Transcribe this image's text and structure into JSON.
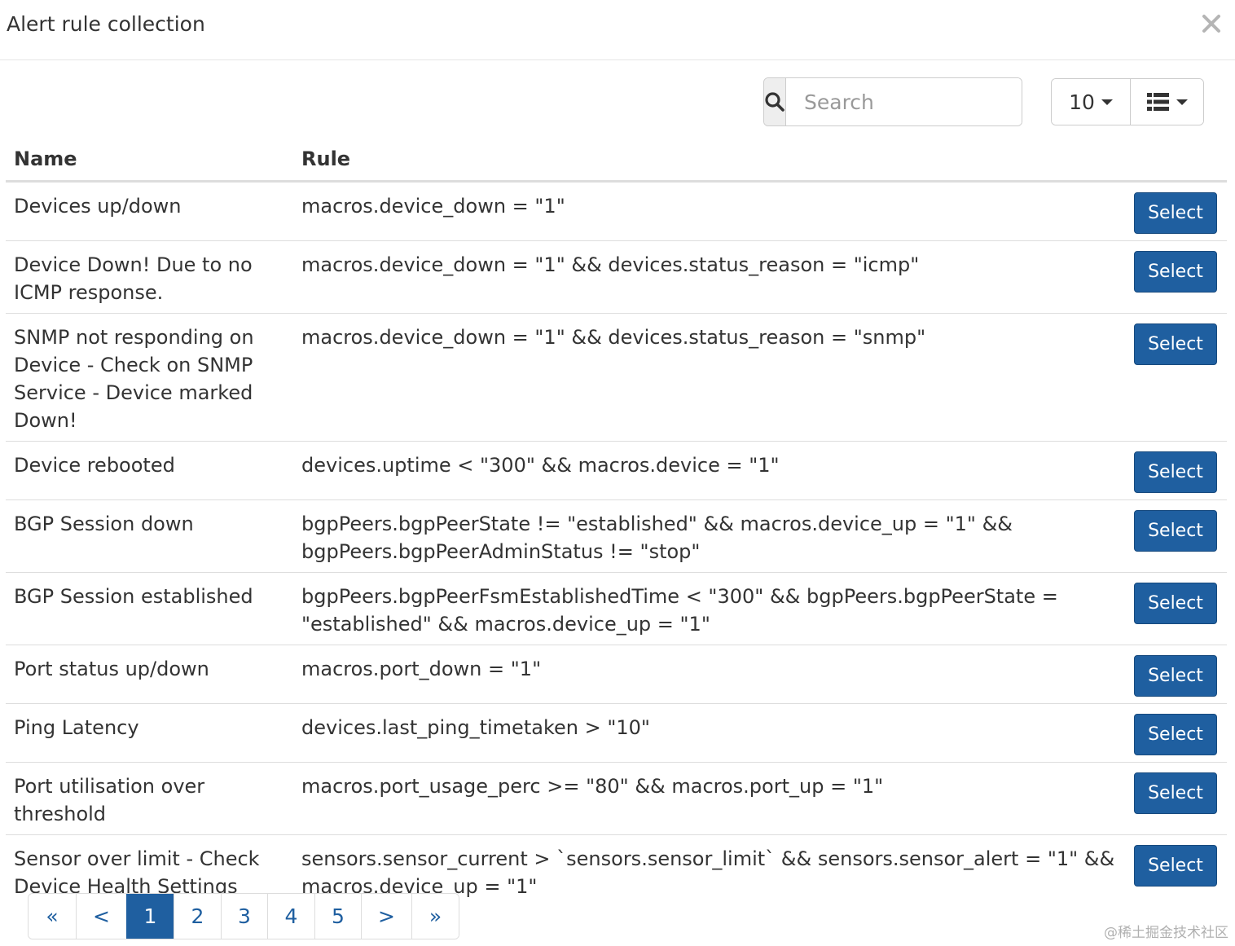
{
  "modal": {
    "title": "Alert rule collection"
  },
  "toolbar": {
    "search_placeholder": "Search",
    "page_size": "10"
  },
  "table": {
    "headers": {
      "name": "Name",
      "rule": "Rule"
    },
    "select_label": "Select",
    "rows": [
      {
        "name": "Devices up/down",
        "rule": "macros.device_down = \"1\""
      },
      {
        "name": "Device Down! Due to no ICMP response.",
        "rule": "macros.device_down = \"1\" && devices.status_reason = \"icmp\""
      },
      {
        "name": "SNMP not responding on Device - Check on SNMP Service - Device marked Down!",
        "rule": "macros.device_down = \"1\" && devices.status_reason = \"snmp\""
      },
      {
        "name": "Device rebooted",
        "rule": "devices.uptime < \"300\" && macros.device = \"1\""
      },
      {
        "name": "BGP Session down",
        "rule": "bgpPeers.bgpPeerState != \"established\" && macros.device_up = \"1\" && bgpPeers.bgpPeerAdminStatus != \"stop\""
      },
      {
        "name": "BGP Session established",
        "rule": "bgpPeers.bgpPeerFsmEstablishedTime < \"300\" && bgpPeers.bgpPeerState = \"established\" && macros.device_up = \"1\""
      },
      {
        "name": "Port status up/down",
        "rule": "macros.port_down = \"1\""
      },
      {
        "name": "Ping Latency",
        "rule": "devices.last_ping_timetaken > \"10\""
      },
      {
        "name": "Port utilisation over threshold",
        "rule": "macros.port_usage_perc >= \"80\" && macros.port_up = \"1\""
      },
      {
        "name": "Sensor over limit - Check Device Health Settings",
        "rule": "sensors.sensor_current > `sensors.sensor_limit` && sensors.sensor_alert = \"1\" && macros.device_up = \"1\""
      }
    ]
  },
  "pagination": {
    "first": "«",
    "prev": "<",
    "pages": [
      "1",
      "2",
      "3",
      "4",
      "5"
    ],
    "next": ">",
    "last": "»",
    "active_page": "1"
  },
  "watermark": "@稀土掘金技术社区",
  "icons": {
    "close": "close-icon",
    "search": "search-icon",
    "page_size_caret": "chevron-down-icon",
    "columns": "list-icon"
  },
  "colors": {
    "primary": "#1f5fa0",
    "border": "#dddddd",
    "text": "#333333",
    "muted": "#999999"
  }
}
